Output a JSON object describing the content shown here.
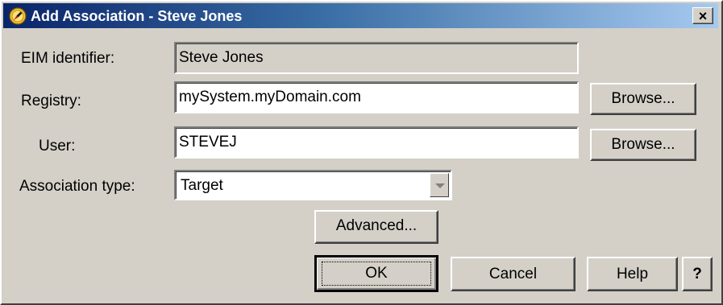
{
  "window": {
    "title": "Add Association - Steve Jones",
    "title_icon": "eim-badge-icon",
    "close_label": "×"
  },
  "form": {
    "eim_identifier_label": "EIM identifier:",
    "eim_identifier_value": "Steve Jones",
    "registry_label": "Registry:",
    "registry_value": "mySystem.myDomain.com",
    "user_label": "User:",
    "user_value": "STEVEJ",
    "association_type_label": "Association type:",
    "association_type_value": "Target"
  },
  "buttons": {
    "browse_registry": "Browse...",
    "browse_user": "Browse...",
    "advanced": "Advanced...",
    "ok": "OK",
    "cancel": "Cancel",
    "help": "Help",
    "whats_this": "?"
  },
  "colors": {
    "title_start": "#0a246a",
    "title_end": "#a6caf0",
    "dialog_bg": "#d4d0c8"
  }
}
